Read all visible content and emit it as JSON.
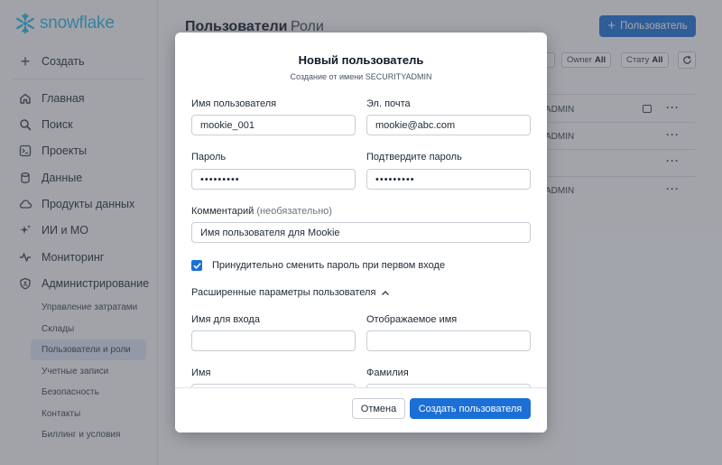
{
  "app": {
    "logo_text": "snowflake",
    "brand_color": "#29b5e8",
    "accent_color": "#1b6fd6"
  },
  "sidebar": {
    "create_label": "Создать",
    "items": [
      {
        "label": "Главная",
        "icon": "home-icon"
      },
      {
        "label": "Поиск",
        "icon": "search-icon"
      },
      {
        "label": "Проекты",
        "icon": "terminal-icon"
      },
      {
        "label": "Данные",
        "icon": "database-icon"
      },
      {
        "label": "Продукты данных",
        "icon": "cloud-icon"
      },
      {
        "label": "ИИ и МО",
        "icon": "sparkle-icon"
      },
      {
        "label": "Мониторинг",
        "icon": "activity-icon"
      },
      {
        "label": "Администрирование",
        "icon": "shield-icon"
      }
    ],
    "sub_items": [
      "Управление затратами",
      "Склады",
      "Пользователи и роли",
      "Учетные записи",
      "Безопасность",
      "Контакты",
      "Биллинг и условия"
    ],
    "active_sub_item": "Пользователи и роли"
  },
  "main": {
    "tabs": [
      "Пользователи",
      "Роли"
    ],
    "add_user_label": "Пользователь",
    "filters": [
      {
        "label": "Owner",
        "value": "All"
      },
      {
        "label": "Стату",
        "value": "All"
      }
    ],
    "rows": [
      "ADMIN",
      "ADMIN",
      "",
      "ADMIN"
    ]
  },
  "modal": {
    "title": "Новый пользователь",
    "subtitle": "Создание от имени SECURITYADMIN",
    "username_label": "Имя пользователя",
    "username_value": "mookie_001",
    "email_label": "Эл. почта",
    "email_value": "mookie@abc.com",
    "password_label": "Пароль",
    "password_value": "•••••••••",
    "confirm_label": "Подтвердите пароль",
    "confirm_value": "•••••••••",
    "comment_label": "Комментарий",
    "comment_optional": "(необязательно)",
    "comment_value": "Имя пользователя для Mookie",
    "force_change_label": "Принудительно сменить пароль при первом входе",
    "force_change_checked": true,
    "advanced_label": "Расширенные параметры пользователя",
    "login_name_label": "Имя для входа",
    "login_name_value": "",
    "display_name_label": "Отображаемое имя",
    "display_name_value": "",
    "first_name_label": "Имя",
    "last_name_label": "Фамилия",
    "cancel_label": "Отмена",
    "create_label": "Создать пользователя"
  }
}
